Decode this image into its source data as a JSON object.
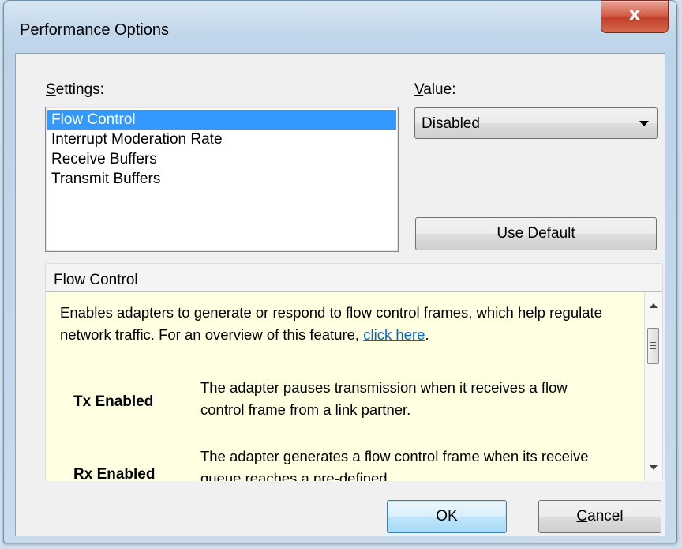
{
  "window": {
    "title": "Performance Options",
    "close_glyph": "x"
  },
  "settings": {
    "label_prefix": "",
    "label_mnemonic": "S",
    "label_rest": "ettings:",
    "items": [
      "Flow Control",
      "Interrupt Moderation Rate",
      "Receive Buffers",
      "Transmit Buffers"
    ],
    "selected": "Flow Control"
  },
  "value": {
    "label_mnemonic": "V",
    "label_rest": "alue:",
    "selected": "Disabled"
  },
  "buttons": {
    "use_default_prefix": "Use ",
    "use_default_mnemonic": "D",
    "use_default_rest": "efault",
    "ok": "OK",
    "cancel_mnemonic": "C",
    "cancel_rest": "ancel"
  },
  "help": {
    "group_title": "Flow Control",
    "intro": "Enables adapters to generate or respond to flow control frames, which help regulate network traffic. For an overview of this feature, ",
    "link_text": "click here",
    "intro_end": ".",
    "terms": [
      {
        "term": "Tx Enabled",
        "desc": "The adapter pauses transmission when it receives a flow control frame from a link partner."
      },
      {
        "term": "Rx Enabled",
        "desc": "The adapter generates a flow control frame when its receive queue reaches a pre-defined"
      }
    ]
  },
  "colors": {
    "selection": "#3399ff",
    "help_background": "#ffffe1",
    "link": "#0066cc",
    "close_button": "#c94a35"
  }
}
